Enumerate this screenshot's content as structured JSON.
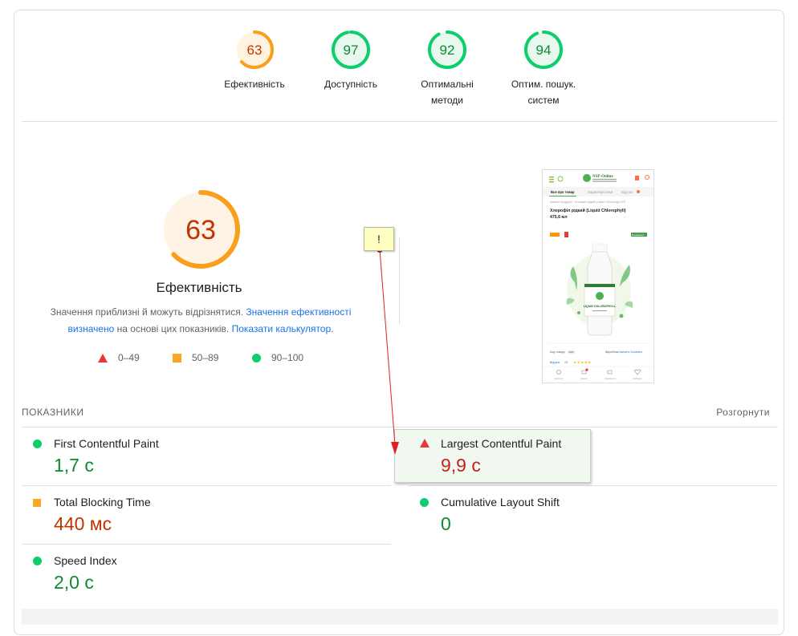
{
  "categories": [
    {
      "score": "63",
      "label": "Ефективність",
      "color": "#fa9f1c",
      "fraction": 0.63
    },
    {
      "score": "97",
      "label": "Доступність",
      "color": "#0cce6b",
      "fraction": 0.97
    },
    {
      "score": "92",
      "label": "Оптимальні методи",
      "color": "#0cce6b",
      "fraction": 0.92
    },
    {
      "score": "94",
      "label": "Оптим. пошук. систем",
      "color": "#0cce6b",
      "fraction": 0.94
    }
  ],
  "main": {
    "score": "63",
    "fraction": 0.63,
    "title": "Ефективність",
    "desc_part1": "Значення приблизні й можуть відрізнятися. ",
    "desc_link1": "Значення ефективності визначено",
    "desc_part2": " на основі цих показників. ",
    "desc_link2": "Показати калькулятор",
    "desc_part3": "."
  },
  "legend": {
    "red": "0–49",
    "orange": "50–89",
    "green": "90–100"
  },
  "note": "!",
  "metrics": {
    "heading": "ПОКАЗНИКИ",
    "expand": "Розгорнути",
    "items": [
      {
        "name": "First Contentful Paint",
        "value": "1,7 с",
        "status": "green"
      },
      {
        "name": "Largest Contentful Paint",
        "value": "9,9 с",
        "status": "red"
      },
      {
        "name": "Total Blocking Time",
        "value": "440 мс",
        "status": "orange"
      },
      {
        "name": "Cumulative Layout Shift",
        "value": "0",
        "status": "green"
      },
      {
        "name": "Speed Index",
        "value": "2,0 с",
        "status": "green"
      }
    ]
  },
  "preview": {
    "site_name": "NSP-Online",
    "tab_all": "Все про товар",
    "tab_specs": "Характеристики",
    "tab_reviews": "Відгуки",
    "breadcrumb": "Каталог продукції › Хлорофіл рідкий (Liquid Chlorophyll) 475",
    "product_title": "Хлорофіл рідкий (Liquid Chlorophyll) 475,6 мл",
    "badge": "В наявності",
    "bottle_label": "LIQUID CHLOROPHYLL",
    "code_label": "Код товару:",
    "code_value": "1580",
    "maker_label": "Виробник:",
    "maker_value": "Nature's Sunshine",
    "reviews_label": "Відгуки",
    "reviews_count": "13",
    "stars": "★★★★★",
    "nav": [
      "каталог",
      "кошик",
      "порівняти",
      "вибране"
    ]
  },
  "colors": {
    "green": "#0cce6b",
    "orange": "#fa9f1c",
    "red": "#e53935",
    "link": "#1a73e8"
  }
}
